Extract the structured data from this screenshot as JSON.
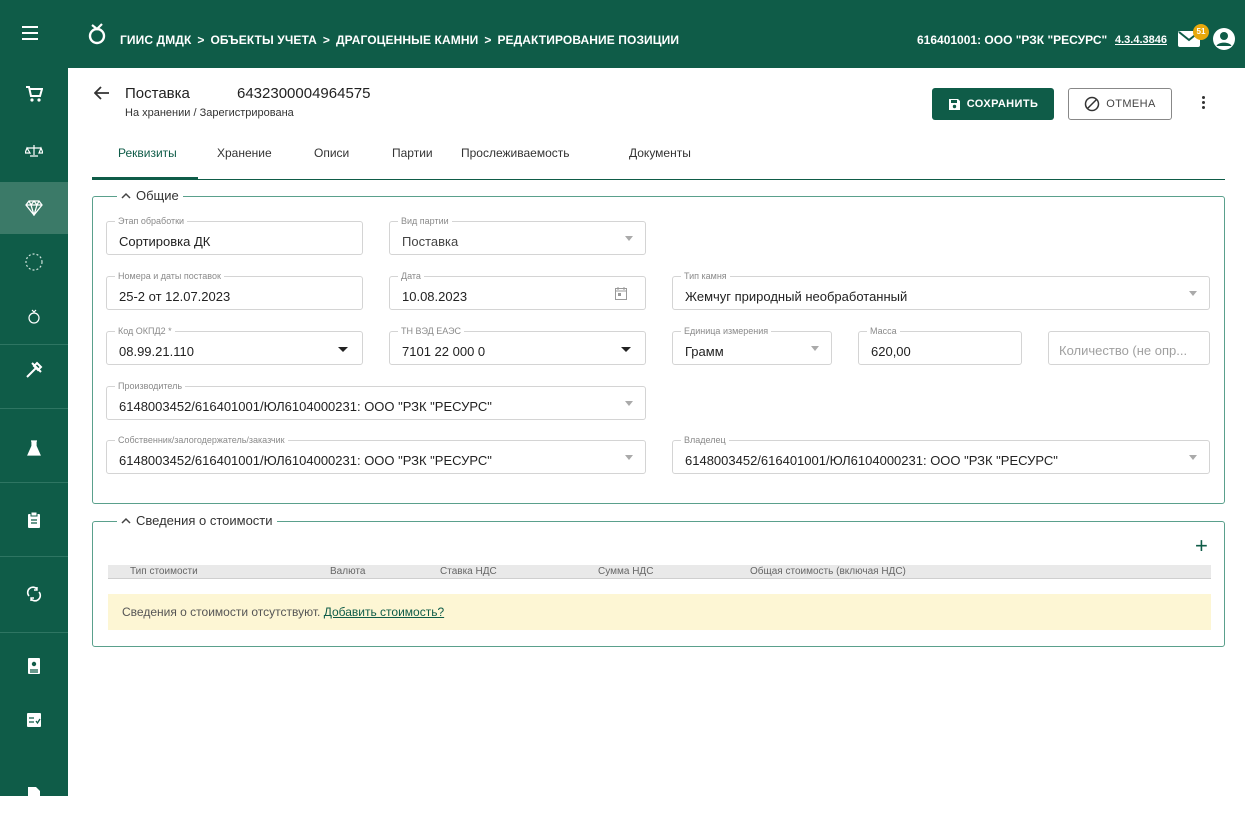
{
  "header": {
    "breadcrumbs": [
      "ГИИС ДМДК",
      "ОБЪЕКТЫ УЧЕТА",
      "ДРАГОЦЕННЫЕ КАМНИ",
      "РЕДАКТИРОВАНИЕ ПОЗИЦИИ"
    ],
    "breadcrumb_separator": ">",
    "organization": "616401001: ООО \"РЗК \"РЕСУРС\"",
    "version": "4.3.4.3846",
    "mail_count": "51"
  },
  "sidebar": {
    "items": [
      {
        "icon": "cart-icon"
      },
      {
        "icon": "scales-icon"
      },
      {
        "icon": "gem-icon",
        "active": true
      },
      {
        "icon": "circle-icon"
      },
      {
        "icon": "ring-icon"
      },
      {
        "icon": "tools-icon"
      },
      {
        "icon": "flask-icon"
      },
      {
        "icon": "clipboard-icon"
      },
      {
        "icon": "sync-icon"
      },
      {
        "icon": "contact-card-icon"
      },
      {
        "icon": "checklist-icon"
      },
      {
        "icon": "document-icon"
      }
    ]
  },
  "page": {
    "title": "Поставка",
    "number": "6432300004964575",
    "status": "На хранении / Зарегистрирована",
    "save_label": "СОХРАНИТЬ",
    "cancel_label": "ОТМЕНА"
  },
  "tabs": [
    {
      "label": "Реквизиты",
      "active": true
    },
    {
      "label": "Хранение"
    },
    {
      "label": "Описи"
    },
    {
      "label": "Партии"
    },
    {
      "label": "Прослеживаемость"
    },
    {
      "label": "Документы"
    }
  ],
  "general": {
    "legend": "Общие",
    "stage": {
      "label": "Этап обработки",
      "value": "Сортировка ДК"
    },
    "batch_type": {
      "label": "Вид партии",
      "value": "Поставка"
    },
    "supply_numbers": {
      "label": "Номера и даты поставок",
      "value": "25-2 от 12.07.2023"
    },
    "date": {
      "label": "Дата",
      "value": "10.08.2023"
    },
    "stone_type": {
      "label": "Тип камня",
      "value": "Жемчуг природный необработанный"
    },
    "okpd2": {
      "label": "Код ОКПД2 *",
      "value": "08.99.21.110"
    },
    "tnved": {
      "label": "ТН ВЭД ЕАЭС",
      "value": "7101 22 000 0"
    },
    "unit": {
      "label": "Единица измерения",
      "value": "Грамм"
    },
    "mass": {
      "label": "Масса",
      "value": "620,00"
    },
    "quantity": {
      "placeholder": "Количество (не опр..."
    },
    "manufacturer": {
      "label": "Производитель",
      "value": "6148003452/616401001/ЮЛ6104000231: ООО \"РЗК \"РЕСУРС\""
    },
    "owner_pledgee": {
      "label": "Собственник/залогодержатель/заказчик",
      "value": "6148003452/616401001/ЮЛ6104000231: ООО \"РЗК \"РЕСУРС\""
    },
    "owner": {
      "label": "Владелец",
      "value": "6148003452/616401001/ЮЛ6104000231: ООО \"РЗК \"РЕСУРС\""
    }
  },
  "cost": {
    "legend": "Сведения о стоимости",
    "add_label": "+",
    "columns": [
      "Тип стоимости",
      "Валюта",
      "Ставка НДС",
      "Сумма НДС",
      "Общая стоимость (включая НДС)"
    ],
    "empty_text": "Сведения о стоимости отсутствуют.",
    "empty_link": "Добавить стоимость?"
  },
  "colors": {
    "brand": "#0f5c48",
    "sidebar_active": "#3b7a68",
    "section_border": "#5aa08c",
    "badge": "#e8a80c",
    "empty_bg": "#fdf6d4"
  }
}
